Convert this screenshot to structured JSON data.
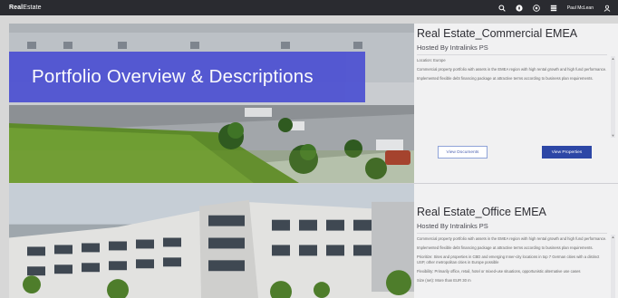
{
  "app": {
    "brand_bold": "Real",
    "brand_rest": "Estate",
    "user_name": "Paul McLean"
  },
  "banner": {
    "text": "Portfolio Overview & Descriptions"
  },
  "portfolios": [
    {
      "title": "Real Estate_Commercial EMEA",
      "hosted_by": "Hosted By Intralinks PS",
      "paragraphs": [
        "Location: Europe",
        "Commercial property portfolio with assets in the EMEA region with high rental growth and high fund performance.",
        "Implemented flexible debt financing package at attractive terms according to business plan requirements."
      ],
      "view_documents_label": "View Documents",
      "view_properties_label": "View Properties"
    },
    {
      "title": "Real Estate_Office EMEA",
      "hosted_by": "Hosted By Intralinks PS",
      "paragraphs": [
        "Commercial property portfolio with assets in the EMEA region with high rental growth and high fund performance.",
        "Implemented flexible debt financing package at attractive terms according to business plan requirements.",
        "Prioritize: Sites and properties in CBD and emerging Inner-city locations in top 7 German cities with a distinct USP, other metropolitan cities in Europe possible",
        "Flexibility: Primarily office, retail, hotel or mixed-use situations, opportunistic alternative use cases",
        "Size (net): More than EUR 30 m"
      ]
    }
  ],
  "icons": {
    "topbar": [
      "search-icon",
      "compass-icon",
      "help-icon",
      "grid-icon",
      "user-icon"
    ]
  },
  "colors": {
    "topbar": "#2a2b30",
    "banner": "#4f53d2",
    "primary_button": "#2d47a6"
  }
}
